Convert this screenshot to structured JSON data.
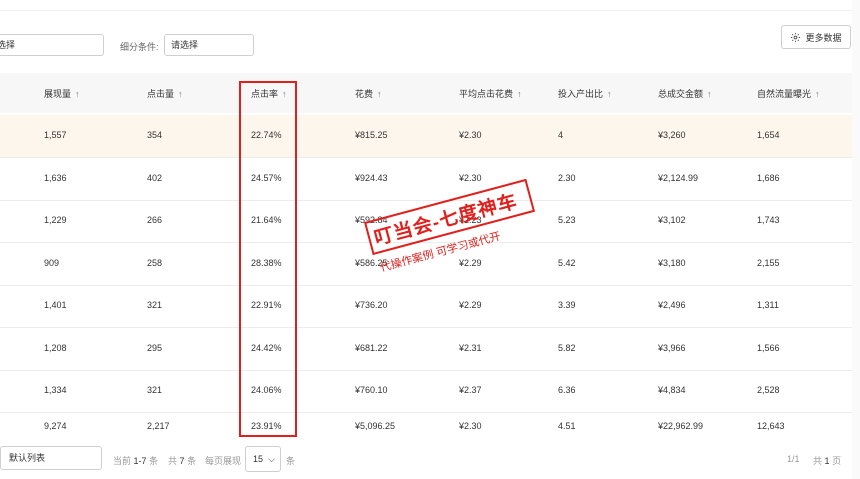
{
  "filters": {
    "first_value": "选择",
    "segment_label": "细分条件:",
    "segment_value": "请选择"
  },
  "more_button": "更多数据",
  "columns": [
    "展现量",
    "点击量",
    "点击率",
    "花费",
    "平均点击花费",
    "投入产出比",
    "总成交金额",
    "自然流量曝光"
  ],
  "sort_arrow": "↑",
  "rows": [
    [
      "1,557",
      "354",
      "22.74%",
      "¥815.25",
      "¥2.30",
      "4",
      "¥3,260",
      "1,654"
    ],
    [
      "1,636",
      "402",
      "24.57%",
      "¥924.43",
      "¥2.30",
      "2.30",
      "¥2,124.99",
      "1,686"
    ],
    [
      "1,229",
      "266",
      "21.64%",
      "¥592.84",
      "¥2.23",
      "5.23",
      "¥3,102",
      "1,743"
    ],
    [
      "909",
      "258",
      "28.38%",
      "¥586.25",
      "¥2.29",
      "5.42",
      "¥3,180",
      "2,155"
    ],
    [
      "1,401",
      "321",
      "22.91%",
      "¥736.20",
      "¥2.29",
      "3.39",
      "¥2,496",
      "1,311"
    ],
    [
      "1,208",
      "295",
      "24.42%",
      "¥681.22",
      "¥2.31",
      "5.82",
      "¥3,966",
      "1,566"
    ],
    [
      "1,334",
      "321",
      "24.06%",
      "¥760.10",
      "¥2.37",
      "6.36",
      "¥4,834",
      "2,528"
    ],
    [
      "9,274",
      "2,217",
      "23.91%",
      "¥5,096.25",
      "¥2.30",
      "4.51",
      "¥22,962.99",
      "12,643"
    ]
  ],
  "footer": {
    "view_select": "默认列表",
    "range_prefix": "当前",
    "range_value": "1-7",
    "range_suffix": "条",
    "total_prefix": "共",
    "total_value": "7",
    "total_suffix": "条",
    "per_page_label": "每页展现",
    "page_size": "15",
    "page_size_suffix": "条",
    "page_indicator": "1/1",
    "pages_prefix": "共",
    "pages_value": "1",
    "pages_suffix": "页"
  },
  "stamp": {
    "line1": "叮当会-七度神车",
    "line2": "代操作案例  可学习或代开"
  },
  "colors": {
    "highlight_row": "#fdf6ec",
    "annotation_red": "#e0201d"
  }
}
